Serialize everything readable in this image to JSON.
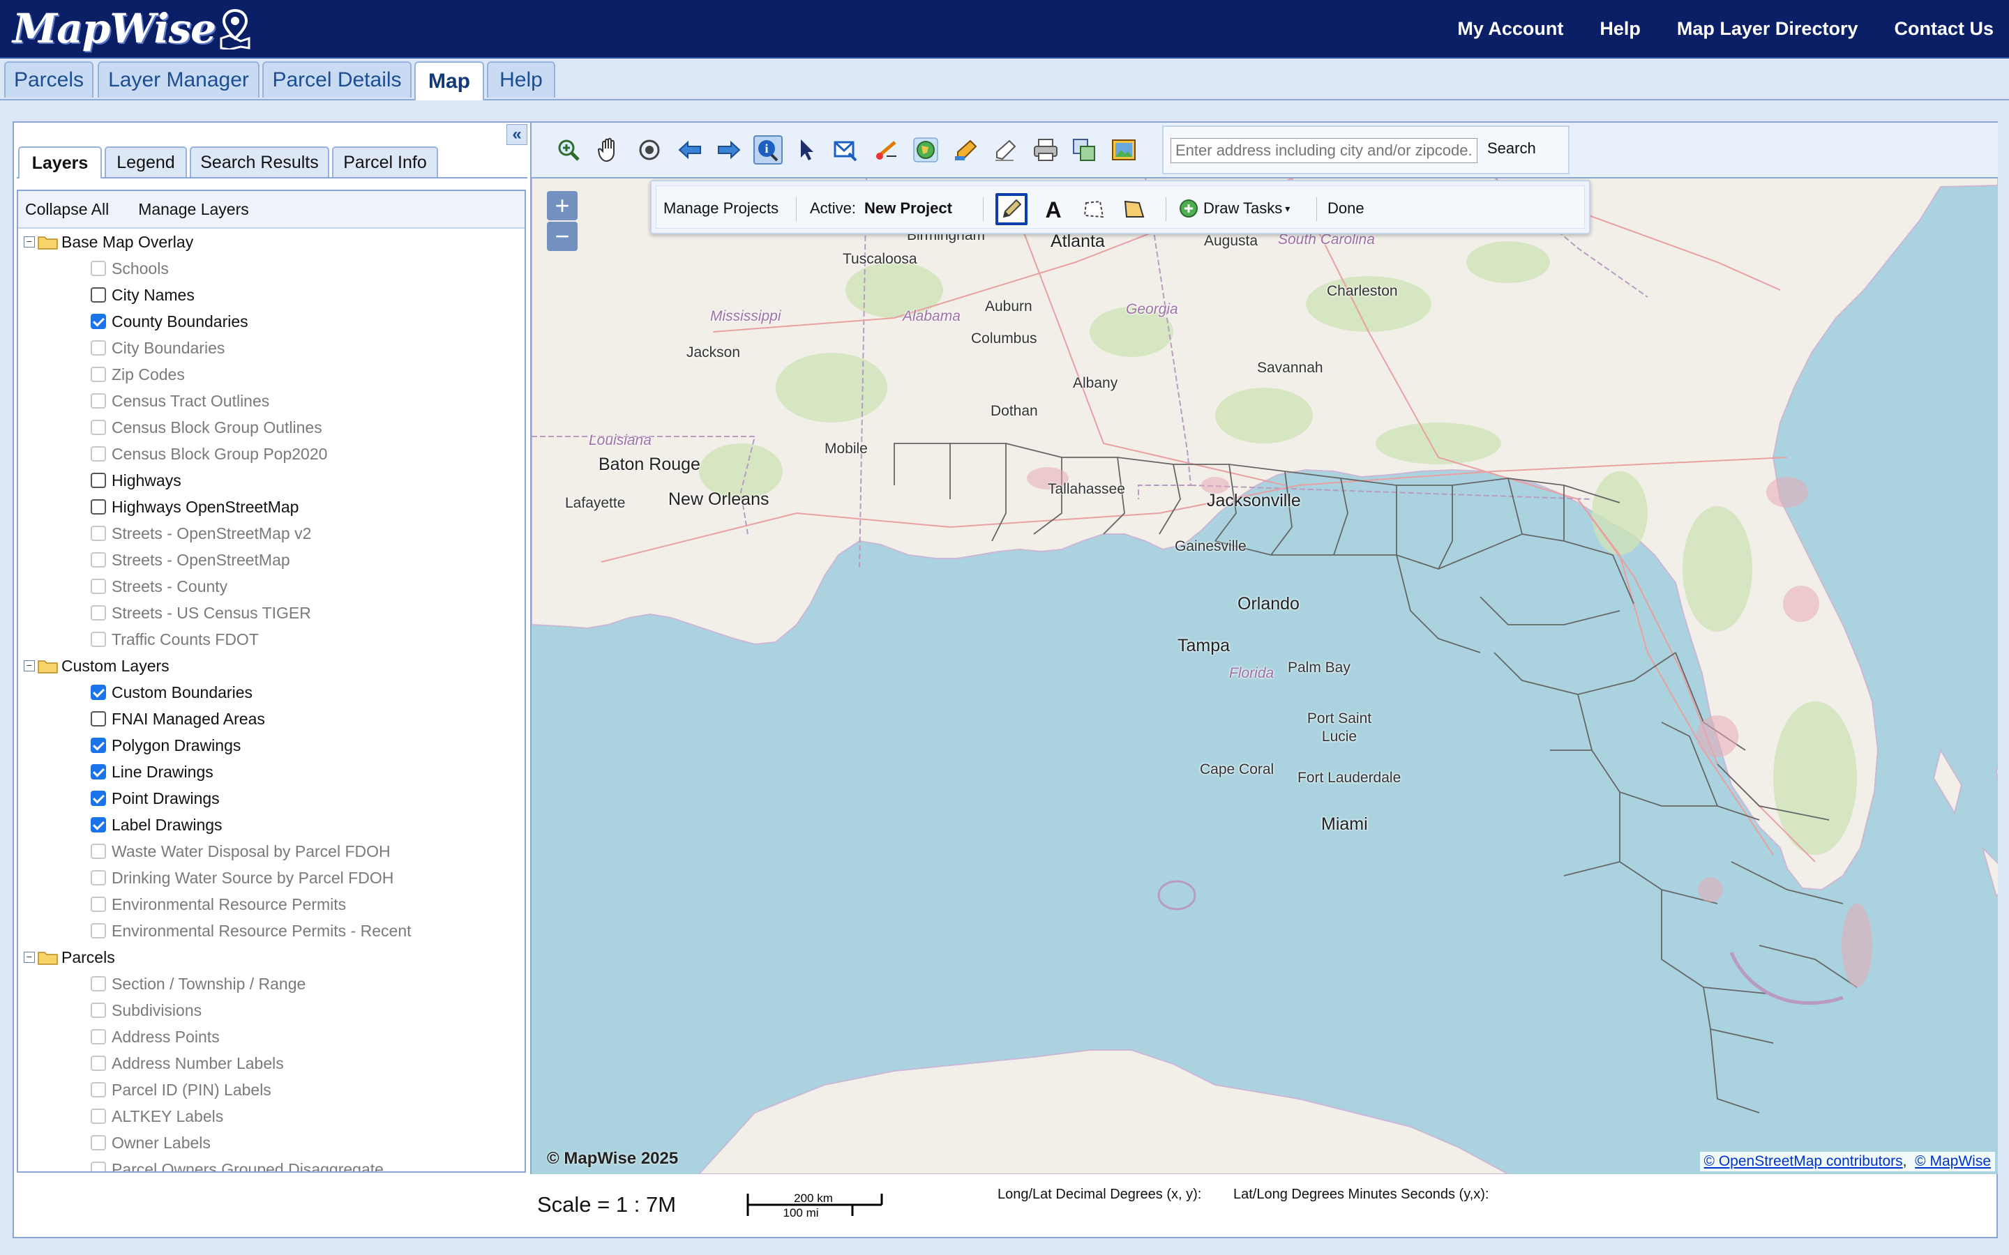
{
  "app": {
    "logo_text": "MapWise",
    "topnav": [
      "My Account",
      "Help",
      "Map Layer Directory",
      "Contact Us"
    ]
  },
  "tabs": [
    "Parcels",
    "Layer Manager",
    "Parcel Details",
    "Map",
    "Help"
  ],
  "active_tab": "Map",
  "left_panel": {
    "collapse_glyph": "«",
    "tabs": [
      "Layers",
      "Legend",
      "Search Results",
      "Parcel Info"
    ],
    "active_tab": "Layers",
    "toolbar": {
      "collapse_all": "Collapse All",
      "manage_layers": "Manage Layers"
    },
    "groups": [
      {
        "name": "Base Map Overlay",
        "toggle": "−",
        "items": [
          {
            "label": "Schools",
            "checked": false,
            "enabled": false
          },
          {
            "label": "City Names",
            "checked": false,
            "enabled": true
          },
          {
            "label": "County Boundaries",
            "checked": true,
            "enabled": true
          },
          {
            "label": "City Boundaries",
            "checked": false,
            "enabled": false
          },
          {
            "label": "Zip Codes",
            "checked": false,
            "enabled": false
          },
          {
            "label": "Census Tract Outlines",
            "checked": false,
            "enabled": false
          },
          {
            "label": "Census Block Group Outlines",
            "checked": false,
            "enabled": false
          },
          {
            "label": "Census Block Group Pop2020",
            "checked": false,
            "enabled": false
          },
          {
            "label": "Highways",
            "checked": false,
            "enabled": true
          },
          {
            "label": "Highways OpenStreetMap",
            "checked": false,
            "enabled": true
          },
          {
            "label": "Streets - OpenStreetMap v2",
            "checked": false,
            "enabled": false
          },
          {
            "label": "Streets - OpenStreetMap",
            "checked": false,
            "enabled": false
          },
          {
            "label": "Streets - County",
            "checked": false,
            "enabled": false
          },
          {
            "label": "Streets - US Census TIGER",
            "checked": false,
            "enabled": false
          },
          {
            "label": "Traffic Counts FDOT",
            "checked": false,
            "enabled": false
          }
        ]
      },
      {
        "name": "Custom Layers",
        "toggle": "−",
        "items": [
          {
            "label": "Custom Boundaries",
            "checked": true,
            "enabled": true
          },
          {
            "label": "FNAI Managed Areas",
            "checked": false,
            "enabled": true
          },
          {
            "label": "Polygon Drawings",
            "checked": true,
            "enabled": true
          },
          {
            "label": "Line Drawings",
            "checked": true,
            "enabled": true
          },
          {
            "label": "Point Drawings",
            "checked": true,
            "enabled": true
          },
          {
            "label": "Label Drawings",
            "checked": true,
            "enabled": true
          },
          {
            "label": "Waste Water Disposal by Parcel FDOH",
            "checked": false,
            "enabled": false
          },
          {
            "label": "Drinking Water Source by Parcel FDOH",
            "checked": false,
            "enabled": false
          },
          {
            "label": "Environmental Resource Permits",
            "checked": false,
            "enabled": false
          },
          {
            "label": "Environmental Resource Permits - Recent",
            "checked": false,
            "enabled": false
          }
        ]
      },
      {
        "name": "Parcels",
        "toggle": "−",
        "items": [
          {
            "label": "Section / Township / Range",
            "checked": false,
            "enabled": false
          },
          {
            "label": "Subdivisions",
            "checked": false,
            "enabled": false
          },
          {
            "label": "Address Points",
            "checked": false,
            "enabled": false
          },
          {
            "label": "Address Number Labels",
            "checked": false,
            "enabled": false
          },
          {
            "label": "Parcel ID (PIN) Labels",
            "checked": false,
            "enabled": false
          },
          {
            "label": "ALTKEY Labels",
            "checked": false,
            "enabled": false
          },
          {
            "label": "Owner Labels",
            "checked": false,
            "enabled": false
          },
          {
            "label": "Parcel Owners Grouped Disaggregate",
            "checked": false,
            "enabled": false
          }
        ]
      }
    ]
  },
  "map": {
    "toolbar_icons": [
      "zoom-in-icon",
      "pan-hand-icon",
      "locate-target-icon",
      "back-arrow-icon",
      "forward-arrow-icon",
      "info-icon",
      "select-pointer-icon",
      "email-map-icon",
      "measure-icon",
      "earth-view-icon",
      "edit-pencil-icon",
      "draw-pencil-icon",
      "print-icon",
      "export-layers-icon",
      "image-export-icon"
    ],
    "search": {
      "placeholder": "Enter address including city and/or zipcode.",
      "value": "",
      "button": "Search"
    },
    "drawbar": {
      "manage_projects": "Manage Projects",
      "active_label": "Active:",
      "active_value": "New Project",
      "draw_tasks": "Draw Tasks",
      "done": "Done"
    },
    "zoom": {
      "in": "+",
      "out": "−"
    },
    "labels": {
      "birmingham": "Birmingham",
      "atlanta": "Atlanta",
      "augusta": "Augusta",
      "south_carolina": "South Carolina",
      "tuscaloosa": "Tuscaloosa",
      "charleston": "Charleston",
      "mississippi": "Mississippi",
      "alabama": "Alabama",
      "auburn": "Auburn",
      "georgia": "Georgia",
      "jackson": "Jackson",
      "columbus": "Columbus",
      "savannah": "Savannah",
      "albany": "Albany",
      "dothan": "Dothan",
      "louisiana": "Louisiana",
      "baton_rouge": "Baton Rouge",
      "mobile": "Mobile",
      "tallahassee": "Tallahassee",
      "new_orleans": "New Orleans",
      "lafayette": "Lafayette",
      "jacksonville": "Jacksonville",
      "gainesville": "Gainesville",
      "orlando": "Orlando",
      "tampa": "Tampa",
      "florida": "Florida",
      "palm_bay": "Palm Bay",
      "port_saint_lucie": "Port Saint Lucie",
      "cape_coral": "Cape Coral",
      "fort_lauderdale": "Fort Lauderdale",
      "miami": "Miami"
    },
    "copyright": "© MapWise 2025",
    "attribution": {
      "osm": "© OpenStreetMap contributors",
      "separator": ",",
      "mapwise": "© MapWise"
    },
    "colors": {
      "water": "#aad3df",
      "land": "#f2efe9",
      "header": "#0a1f66"
    }
  },
  "status": {
    "scale": "Scale = 1 : 7M",
    "scalebar_km": "200 km",
    "scalebar_mi": "100 mi",
    "lonlat_label": "Long/Lat Decimal Degrees (x, y):",
    "dms_label": "Lat/Long Degrees Minutes Seconds (y,x):"
  }
}
